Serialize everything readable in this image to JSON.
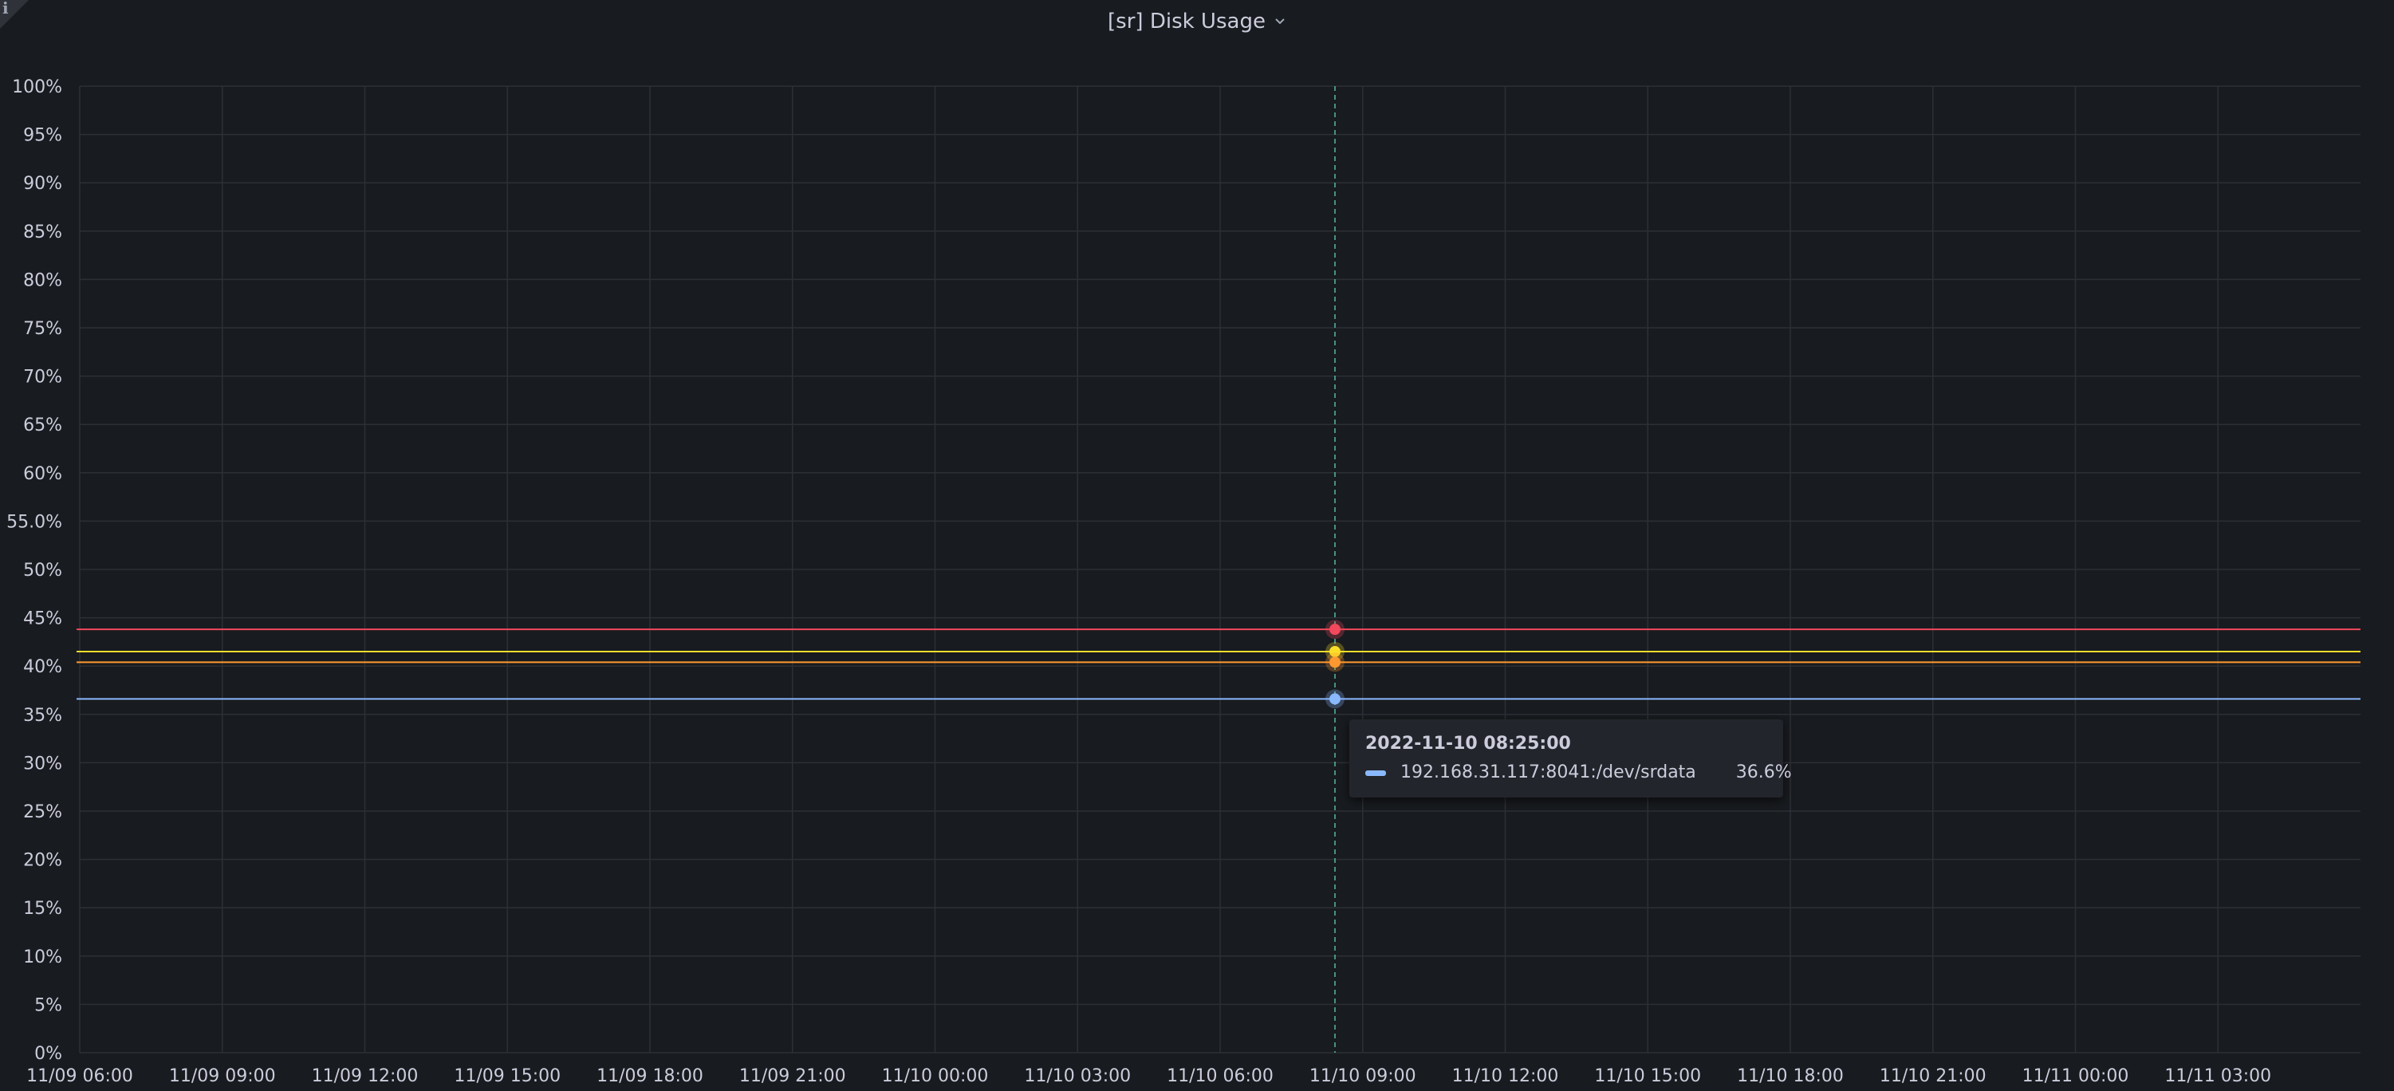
{
  "panel": {
    "title": "[sr] Disk Usage",
    "info_icon": "info-icon",
    "menu_icon": "chevron-down-icon"
  },
  "tooltip": {
    "time": "2022-11-10 08:25:00",
    "series_name": "192.168.31.117:8041:/dev/srdata",
    "value": "36.6%",
    "color": "#8ab8ff"
  },
  "colors": {
    "background": "#181b1f",
    "grid": "#2c3036",
    "text": "#ccccdc",
    "crosshair": "#58b9a6"
  },
  "chart_data": {
    "type": "line",
    "y_ticks": [
      "0%",
      "5%",
      "10%",
      "15%",
      "20%",
      "25%",
      "30%",
      "35%",
      "40%",
      "45%",
      "50%",
      "55.0%",
      "60%",
      "65%",
      "70%",
      "75%",
      "80%",
      "85%",
      "90%",
      "95%",
      "100%"
    ],
    "ylim": [
      0,
      100
    ],
    "x_ticks": [
      "11/09 06:00",
      "11/09 09:00",
      "11/09 12:00",
      "11/09 15:00",
      "11/09 18:00",
      "11/09 21:00",
      "11/10 00:00",
      "11/10 03:00",
      "11/10 06:00",
      "11/10 09:00",
      "11/10 12:00",
      "11/10 15:00",
      "11/10 18:00",
      "11/10 21:00",
      "11/11 00:00",
      "11/11 03:00"
    ],
    "xlim": [
      "2022-11-09 06:00",
      "2022-11-11 06:00"
    ],
    "hover_time": "2022-11-10 08:25",
    "grid": true,
    "series": [
      {
        "values": [
          43.8,
          43.8
        ],
        "color": "#f2495c"
      },
      {
        "values": [
          41.5,
          41.5
        ],
        "color": "#fade2a"
      },
      {
        "values": [
          40.4,
          40.4
        ],
        "color": "#ff9830"
      },
      {
        "name": "192.168.31.117:8041:/dev/srdata",
        "values": [
          36.6,
          36.6
        ],
        "color": "#8ab8ff"
      }
    ]
  }
}
